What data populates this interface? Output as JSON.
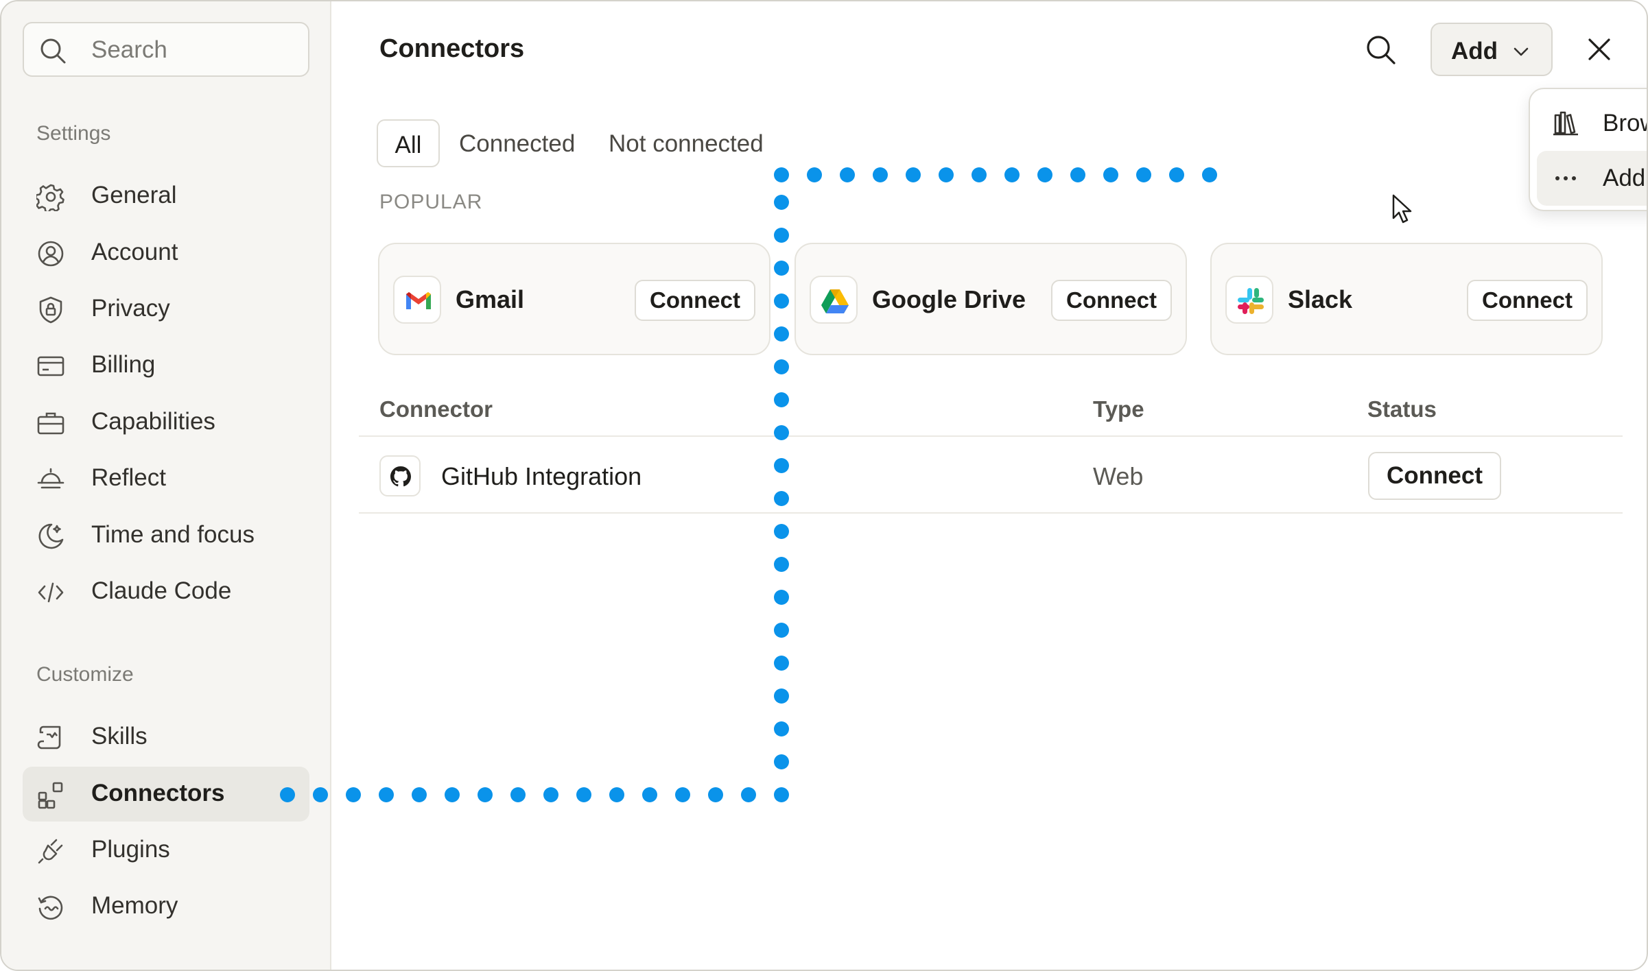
{
  "sidebar": {
    "search_placeholder": "Search",
    "sections": {
      "settings": "Settings",
      "customize": "Customize"
    },
    "settings_items": [
      {
        "label": "General",
        "icon": "gear-icon"
      },
      {
        "label": "Account",
        "icon": "user-circle-icon"
      },
      {
        "label": "Privacy",
        "icon": "shield-lock-icon"
      },
      {
        "label": "Billing",
        "icon": "credit-card-icon"
      },
      {
        "label": "Capabilities",
        "icon": "briefcase-icon"
      },
      {
        "label": "Reflect",
        "icon": "sunrise-icon"
      },
      {
        "label": "Time and focus",
        "icon": "moon-icon"
      },
      {
        "label": "Claude Code",
        "icon": "code-icon"
      }
    ],
    "customize_items": [
      {
        "label": "Skills",
        "icon": "scroll-icon"
      },
      {
        "label": "Connectors",
        "icon": "grid-plus-icon",
        "active": true
      },
      {
        "label": "Plugins",
        "icon": "plug-icon"
      },
      {
        "label": "Memory",
        "icon": "history-icon"
      }
    ]
  },
  "header": {
    "title": "Connectors",
    "add_label": "Add"
  },
  "tabs": [
    "All",
    "Connected",
    "Not connected"
  ],
  "popular": {
    "label": "POPULAR",
    "cards": [
      {
        "name": "Gmail",
        "button": "Connect",
        "icon": "gmail-icon"
      },
      {
        "name": "Google Drive",
        "button": "Connect",
        "icon": "google-drive-icon"
      },
      {
        "name": "Slack",
        "button": "Connect",
        "icon": "slack-icon"
      }
    ]
  },
  "table": {
    "columns": [
      "Connector",
      "Type",
      "Status"
    ],
    "rows": [
      {
        "name": "GitHub Integration",
        "type": "Web",
        "status_button": "Connect",
        "icon": "github-icon"
      }
    ]
  },
  "add_menu": {
    "items": [
      {
        "label": "Browse connectors",
        "icon": "books-icon"
      },
      {
        "label": "Add custom connector",
        "icon": "more-horizontal-icon"
      }
    ]
  },
  "colors": {
    "highlight_dots": "#0a93ea",
    "sidebar_bg": "#f6f5f2",
    "active_item_bg": "#e9e8e3"
  }
}
